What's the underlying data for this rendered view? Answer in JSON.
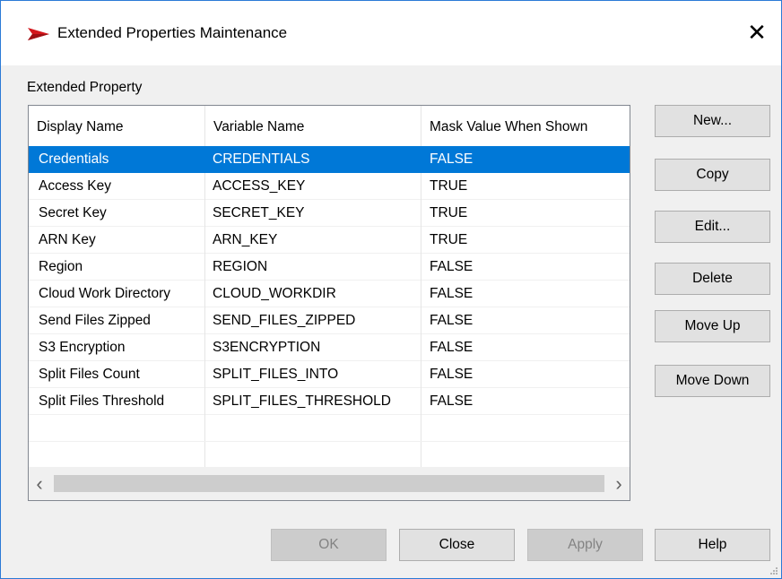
{
  "window": {
    "title": "Extended Properties Maintenance",
    "close_glyph": "✕"
  },
  "group_label": "Extended Property",
  "columns": [
    "Display Name",
    "Variable Name",
    "Mask Value When Shown"
  ],
  "rows": [
    {
      "display": "Credentials",
      "variable": "CREDENTIALS",
      "mask": "FALSE",
      "selected": true
    },
    {
      "display": "Access Key",
      "variable": "ACCESS_KEY",
      "mask": "TRUE"
    },
    {
      "display": "Secret Key",
      "variable": "SECRET_KEY",
      "mask": "TRUE"
    },
    {
      "display": "ARN Key",
      "variable": "ARN_KEY",
      "mask": "TRUE"
    },
    {
      "display": "Region",
      "variable": "REGION",
      "mask": "FALSE"
    },
    {
      "display": "Cloud Work Directory",
      "variable": "CLOUD_WORKDIR",
      "mask": "FALSE"
    },
    {
      "display": "Send Files Zipped",
      "variable": "SEND_FILES_ZIPPED",
      "mask": "FALSE"
    },
    {
      "display": "S3 Encryption",
      "variable": "S3ENCRYPTION",
      "mask": "FALSE"
    },
    {
      "display": "Split Files Count",
      "variable": "SPLIT_FILES_INTO",
      "mask": "FALSE"
    },
    {
      "display": "Split Files Threshold",
      "variable": "SPLIT_FILES_THRESHOLD",
      "mask": "FALSE"
    }
  ],
  "side_buttons": {
    "new": "New...",
    "copy": "Copy",
    "edit": "Edit...",
    "delete": "Delete",
    "move_up": "Move Up",
    "move_down": "Move Down"
  },
  "bottom_buttons": {
    "ok": "OK",
    "close": "Close",
    "apply": "Apply",
    "help": "Help"
  },
  "scrollbar": {
    "left_glyph": "‹",
    "right_glyph": "›"
  },
  "colors": {
    "selection": "#0078d7",
    "window_border": "#2b7ad6",
    "app_icon": "#d4161c"
  }
}
